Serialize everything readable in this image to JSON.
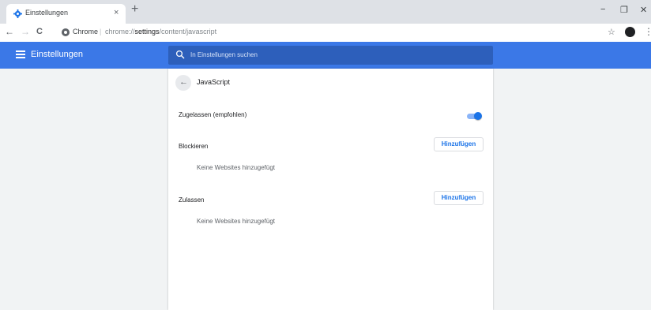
{
  "tab": {
    "title": "Einstellungen",
    "close": "×",
    "new_tab": "+"
  },
  "window": {
    "minimize": "−",
    "restore": "❐",
    "close": "✕"
  },
  "toolbar": {
    "back": "←",
    "forward": "→",
    "reload": "C",
    "origin": "Chrome",
    "separator": "|",
    "url_prefix": "chrome://",
    "url_host": "settings",
    "url_path": "/content/javascript",
    "star": "☆",
    "menu": "⋮"
  },
  "header": {
    "title": "Einstellungen",
    "search_placeholder": "In Einstellungen suchen",
    "color": "#3b78e7"
  },
  "page": {
    "back": "←",
    "title": "JavaScript",
    "allowed_label": "Zugelassen (empfohlen)",
    "allowed_toggle_on": true,
    "block": {
      "label": "Blockieren",
      "add_button": "Hinzufügen",
      "empty": "Keine Websites hinzugefügt"
    },
    "allow": {
      "label": "Zulassen",
      "add_button": "Hinzufügen",
      "empty": "Keine Websites hinzugefügt"
    }
  },
  "icons": {
    "favicon": "gear-icon",
    "search": "search-icon",
    "menu": "hamburger-icon",
    "profile": "profile-avatar"
  }
}
